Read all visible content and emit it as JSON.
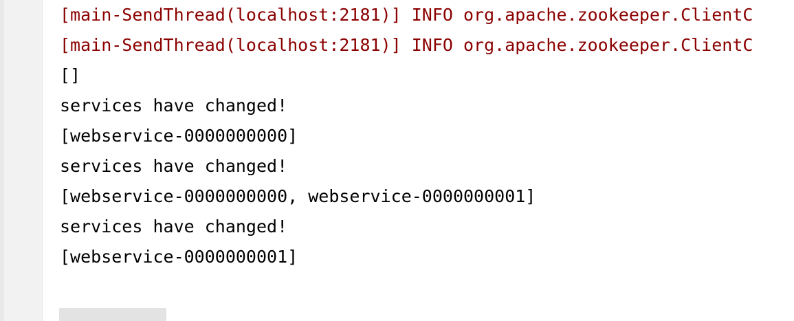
{
  "console": {
    "lines": [
      {
        "text": "[main-SendThread(localhost:2181)] INFO org.apache.zookeeper.ClientC",
        "stream": "stderr"
      },
      {
        "text": "[main-SendThread(localhost:2181)] INFO org.apache.zookeeper.ClientC",
        "stream": "stderr"
      },
      {
        "text": "[]",
        "stream": "stdout"
      },
      {
        "text": "services have changed!",
        "stream": "stdout"
      },
      {
        "text": "[webservice-0000000000]",
        "stream": "stdout"
      },
      {
        "text": "services have changed!",
        "stream": "stdout"
      },
      {
        "text": "[webservice-0000000000, webservice-0000000001]",
        "stream": "stdout"
      },
      {
        "text": "services have changed!",
        "stream": "stdout"
      },
      {
        "text": "[webservice-0000000001]",
        "stream": "stdout"
      }
    ]
  },
  "colors": {
    "stderr_text": "#8b0000",
    "stdout_text": "#000000",
    "gutter_bg": "#f2f2f2",
    "scrollbar_thumb": "#e3e3e3"
  }
}
